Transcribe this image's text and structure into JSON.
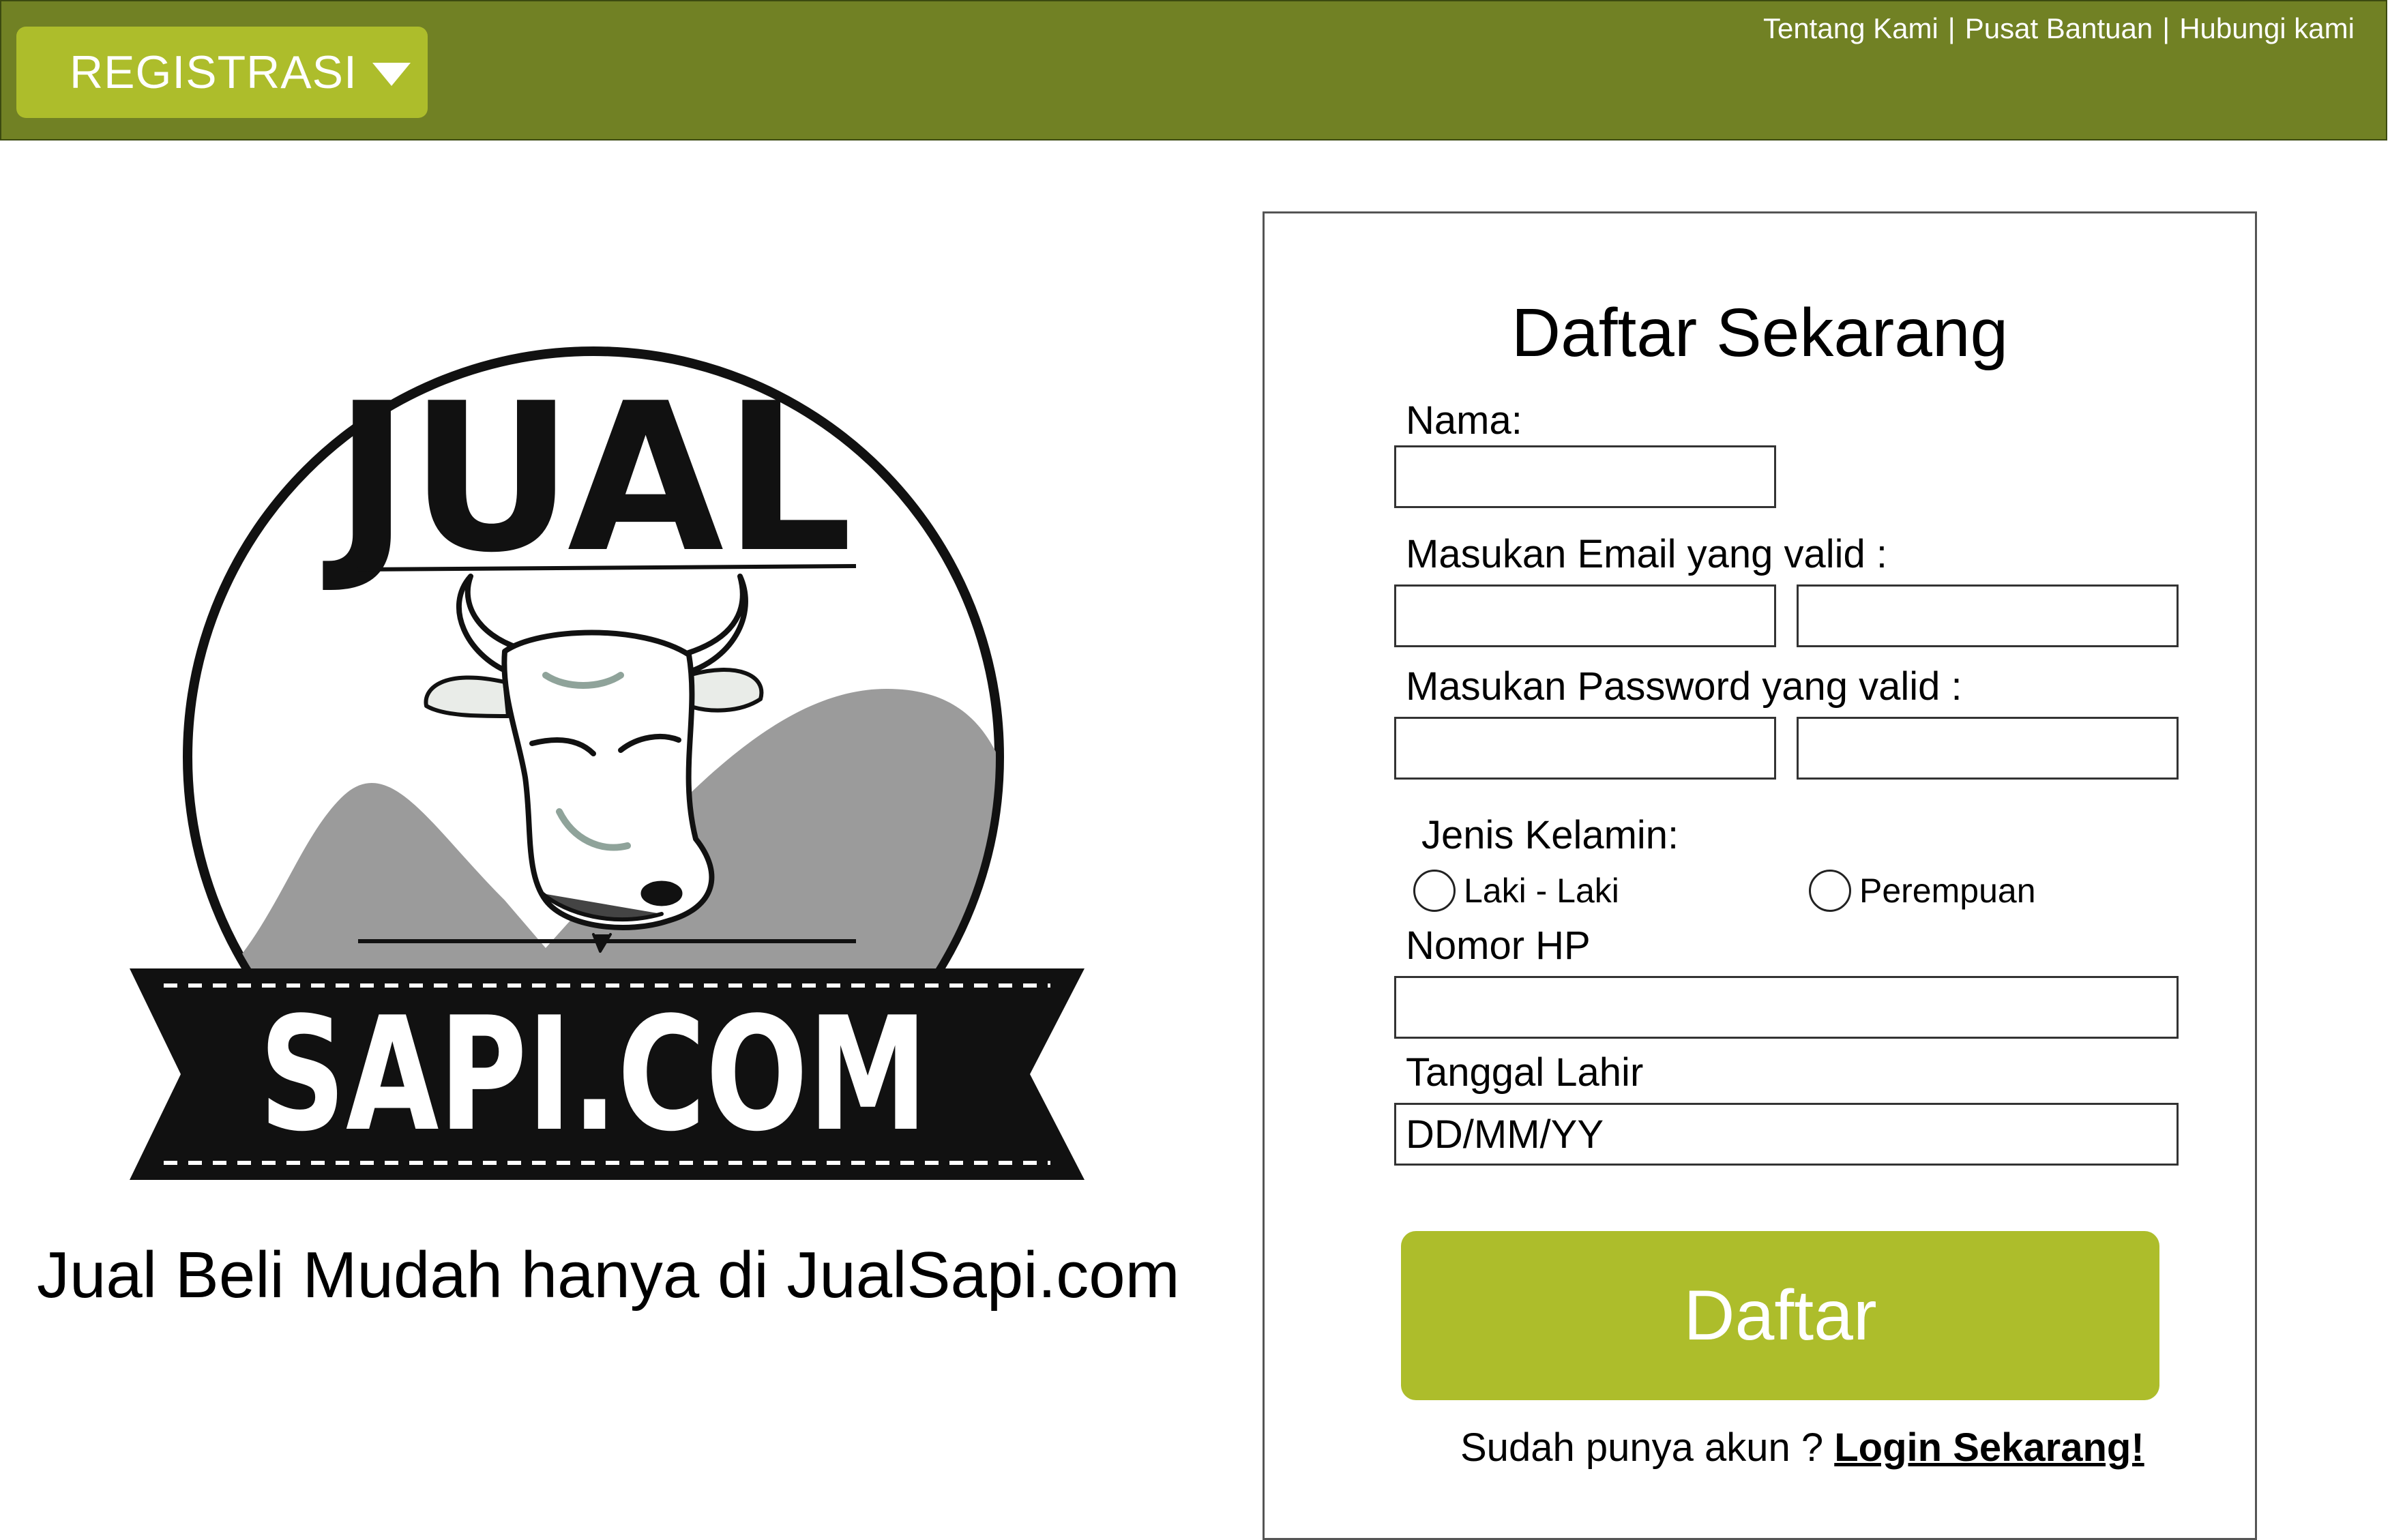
{
  "header": {
    "register_label": "REGISTRASI",
    "links": [
      "Tentang Kami",
      "Pusat Bantuan",
      "Hubungi kami"
    ],
    "separator": "|"
  },
  "brand": {
    "logo_top": "JUAL",
    "logo_bottom": "SAPI.COM",
    "tagline": "Jual Beli Mudah hanya di JualSapi.com"
  },
  "form": {
    "title": "Daftar Sekarang",
    "name_label": "Nama:",
    "name_value": "",
    "email_label": "Masukan Email yang valid :",
    "email_value": "",
    "email_confirm_value": "",
    "password_label": "Masukan Password yang valid :",
    "password_value": "",
    "password_confirm_value": "",
    "gender_label": "Jenis Kelamin:",
    "gender_options": [
      "Laki - Laki",
      "Perempuan"
    ],
    "phone_label": "Nomor HP",
    "phone_value": "",
    "birthdate_label": "Tanggal Lahir",
    "birthdate_placeholder": "DD/MM/YY",
    "submit_label": "Daftar",
    "login_prompt": "Sudah punya akun ?",
    "login_link": "Login Sekarang!"
  },
  "colors": {
    "header_bg": "#718124",
    "accent": "#adbd2b",
    "logo_dark": "#111111",
    "mountain": "#9b9b9b"
  }
}
